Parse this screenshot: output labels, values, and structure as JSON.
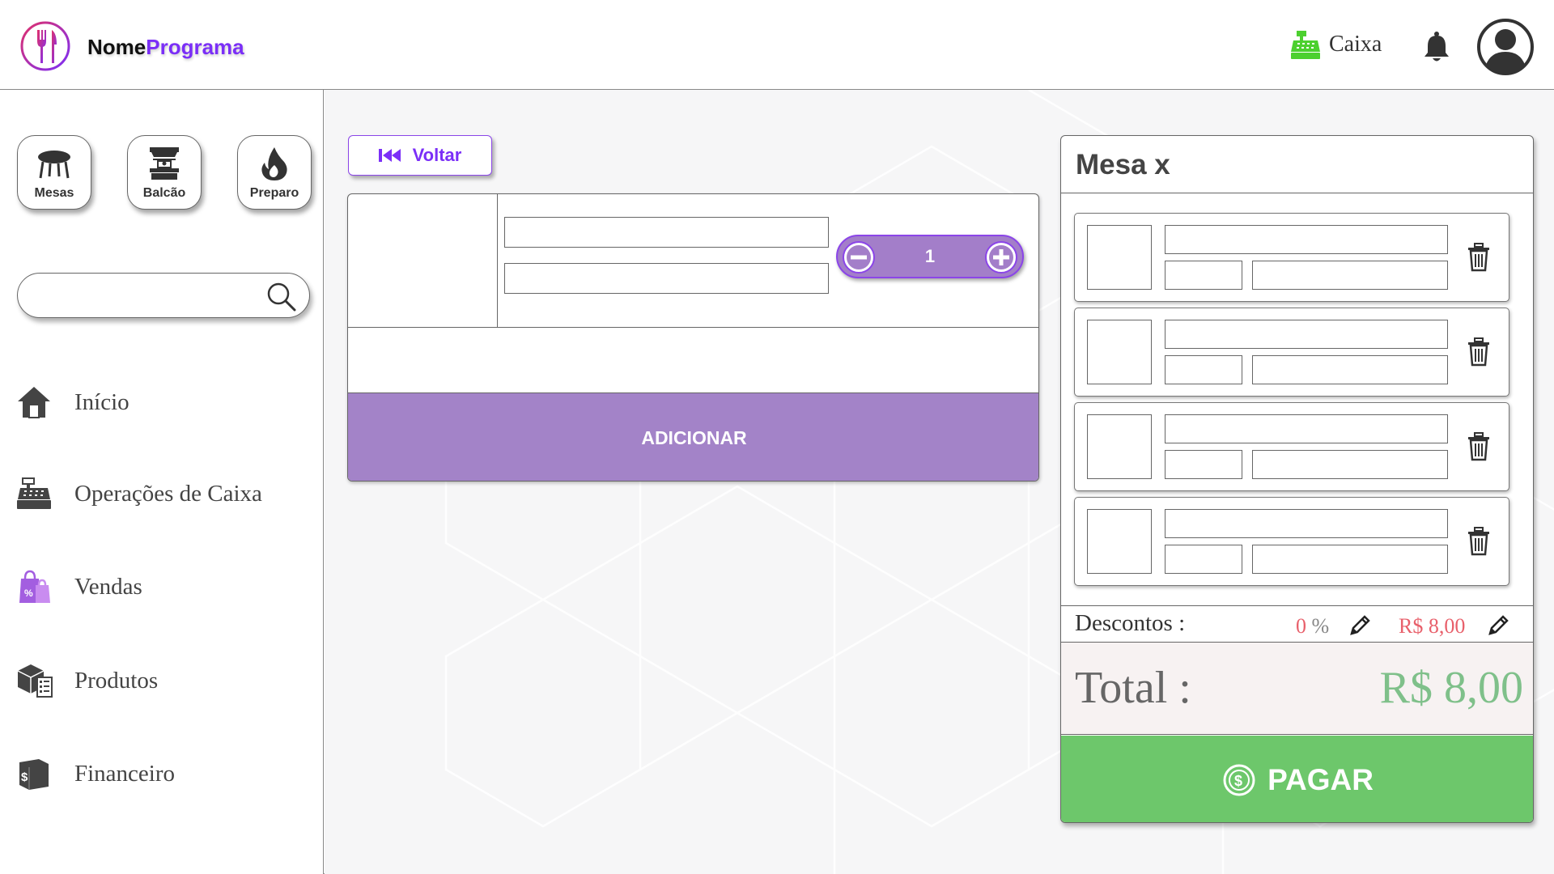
{
  "header": {
    "app_name_part1": "Nome",
    "app_name_part2": "Programa",
    "logo_icon": "fork-knife-icon",
    "cash_label": "Caixa",
    "cash_icon": "cash-register-icon",
    "bell_icon": "bell-icon",
    "avatar_icon": "user-avatar-icon"
  },
  "sidebar": {
    "quick_buttons": [
      {
        "label": "Mesas",
        "icon": "table-icon"
      },
      {
        "label": "Balcão",
        "icon": "counter-icon"
      },
      {
        "label": "Preparo",
        "icon": "fire-icon"
      }
    ],
    "search": {
      "placeholder": "",
      "value": ""
    },
    "nav": [
      {
        "label": "Início",
        "icon": "home-icon"
      },
      {
        "label": "Operações de Caixa",
        "icon": "cash-register-icon"
      },
      {
        "label": "Vendas",
        "icon": "shopping-bags-icon"
      },
      {
        "label": "Produtos",
        "icon": "boxes-icon"
      },
      {
        "label": "Financeiro",
        "icon": "money-book-icon"
      }
    ]
  },
  "main": {
    "back_label": "Voltar",
    "product": {
      "quantity": "1",
      "add_label": "ADICIONAR"
    }
  },
  "order": {
    "title": "Mesa x",
    "items_count": 4,
    "discounts_label": "Descontos :",
    "discount_percent": "0",
    "discount_percent_unit": "%",
    "discount_value": "R$ 8,00",
    "total_label": "Total :",
    "total_value": "R$ 8,00",
    "pay_label": "PAGAR"
  },
  "colors": {
    "accent_purple": "#7b2ff7",
    "add_button": "#a383c8",
    "pay_button": "#6dc76b",
    "discount_red": "#e8606b",
    "total_green": "#7fc08a"
  }
}
